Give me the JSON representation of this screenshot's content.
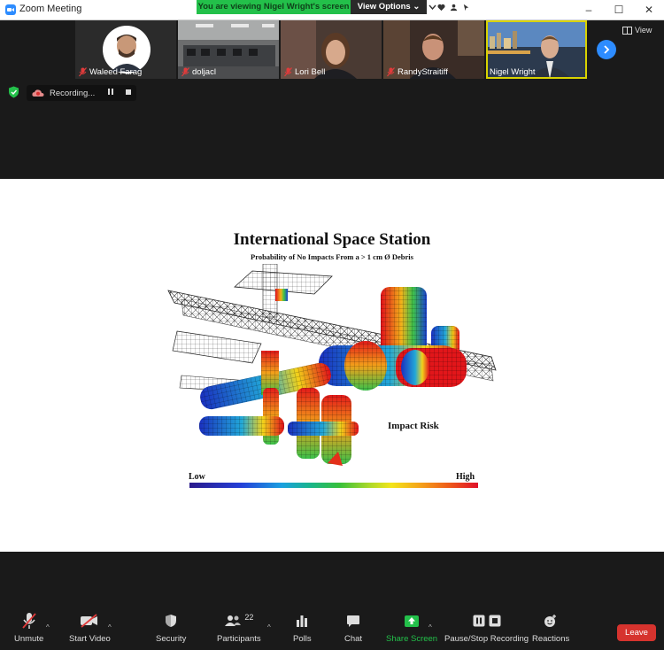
{
  "window": {
    "title": "Zoom Meeting"
  },
  "banner": {
    "viewing": "You are viewing Nigel Wright's screen",
    "view_options": "View Options"
  },
  "participants_strip": [
    {
      "name": "Waleed Farag",
      "muted": true
    },
    {
      "name": "doljacl",
      "muted": true
    },
    {
      "name": "Lori Bell",
      "muted": true
    },
    {
      "name": "RandyStraitiff",
      "muted": true
    },
    {
      "name": "Nigel Wright",
      "muted": false,
      "active_speaker": true
    }
  ],
  "view_button": "View",
  "recording": {
    "label": "Recording..."
  },
  "shared_slide": {
    "title": "International Space Station",
    "subtitle": "Probability of No Impacts From a > 1 cm Ø Debris",
    "impact_label": "Impact Risk",
    "scale_low": "Low",
    "scale_high": "High"
  },
  "toolbar": {
    "unmute": "Unmute",
    "start_video": "Start Video",
    "security": "Security",
    "participants": "Participants",
    "participants_count": "22",
    "polls": "Polls",
    "chat": "Chat",
    "share_screen": "Share Screen",
    "recording": "Pause/Stop Recording",
    "reactions": "Reactions",
    "leave": "Leave"
  },
  "colors": {
    "accent": "#2d8cff",
    "share_green": "#23c04a",
    "leave_red": "#d6332e",
    "active_outline": "#d9d300"
  }
}
